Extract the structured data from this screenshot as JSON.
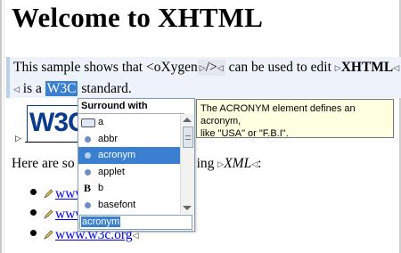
{
  "heading": "Welcome to XHTML",
  "paragraph1": {
    "text_a": "This sample shows that <oXygen",
    "tag_a": "/>",
    "text_b": "can be used to edit",
    "bold": "XHTML",
    "text_c": "is a",
    "selected": "W3C",
    "text_d": "standard."
  },
  "image_alt_logo": "W3C",
  "paragraph2": {
    "text_a": "Here are so",
    "text_b": "ing",
    "italic": "XML",
    "text_c": ":"
  },
  "links": [
    {
      "text": "www."
    },
    {
      "text": "www."
    },
    {
      "text": "www.w3c.org"
    }
  ],
  "popup": {
    "title": "Surround with",
    "items": [
      {
        "label": "a",
        "icon": "keyboard-icon"
      },
      {
        "label": "abbr",
        "icon": "element-dot-icon"
      },
      {
        "label": "acronym",
        "icon": "element-dot-icon",
        "active": true
      },
      {
        "label": "applet",
        "icon": "element-dot-icon"
      },
      {
        "label": "b",
        "icon": "bold-icon"
      },
      {
        "label": "basefont",
        "icon": "element-dot-icon"
      }
    ],
    "filter_value": "acronym"
  },
  "tooltip": {
    "line1": "The ACRONYM element defines an acronym,",
    "line2": "like \"USA\" or \"F.B.I\"."
  },
  "colors": {
    "selection": "#3a7fd0",
    "tooltip_bg": "#ffffe1",
    "link": "#0000ee",
    "current_line": "#eef3fb"
  }
}
